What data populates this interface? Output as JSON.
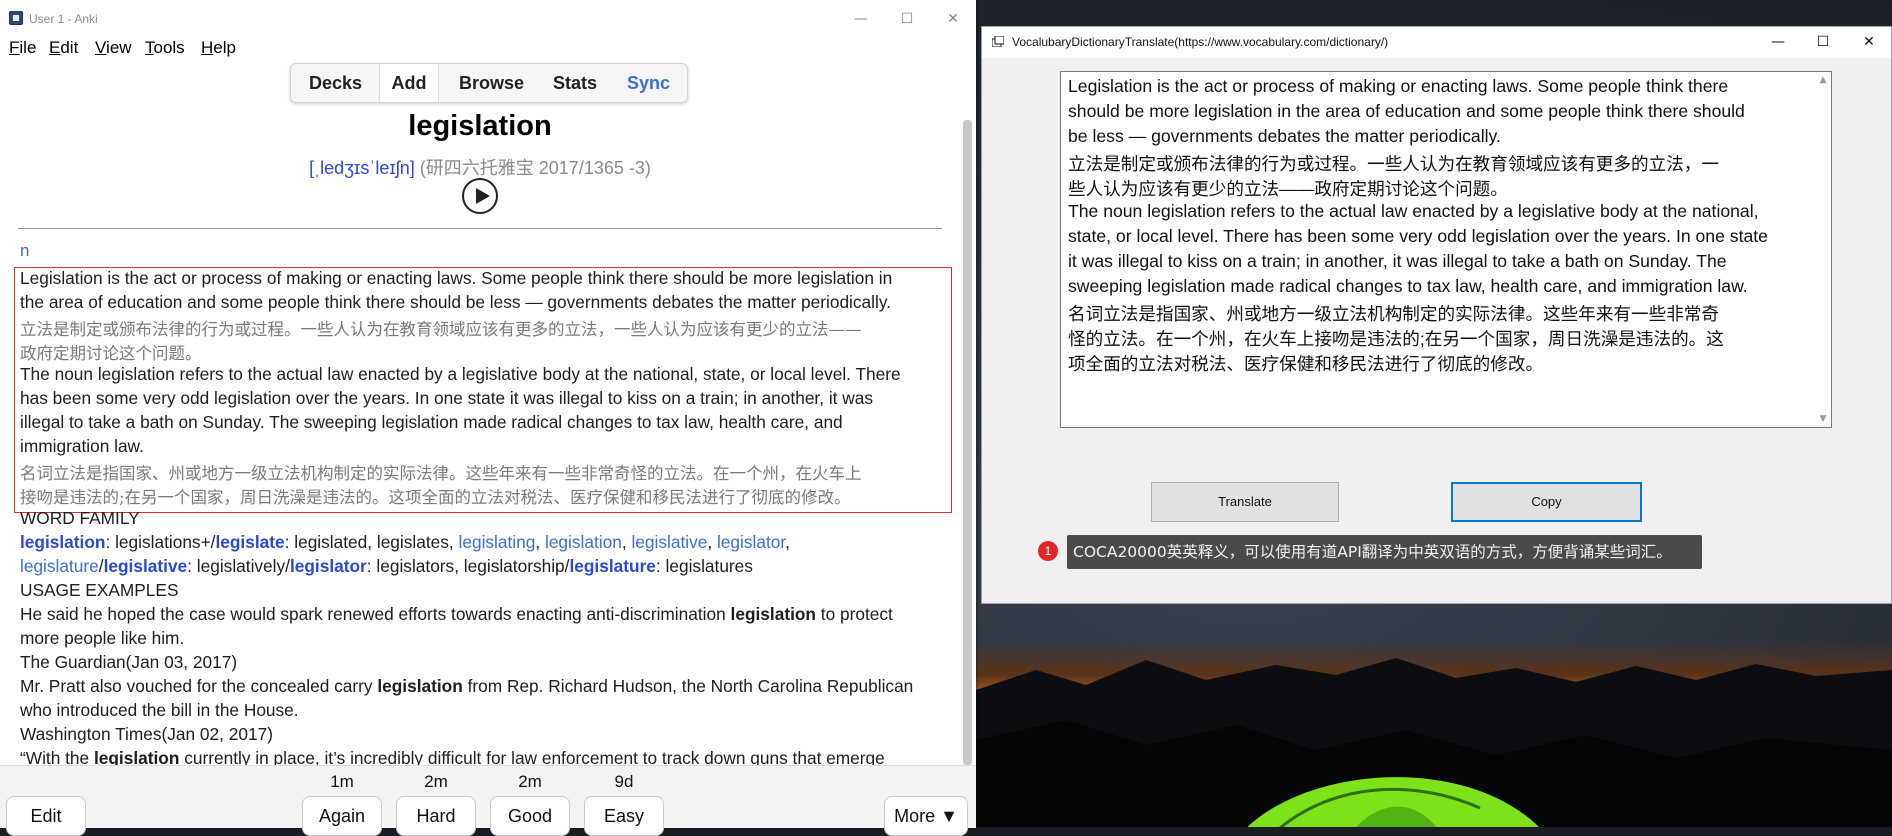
{
  "anki": {
    "window_title": "User 1 - Anki",
    "menu": [
      "File",
      "Edit",
      "View",
      "Tools",
      "Help"
    ],
    "menu_underline": [
      "F",
      "E",
      "V",
      "T",
      "H"
    ],
    "menu_rest": [
      "ile",
      "dit",
      "iew",
      "ools",
      "elp"
    ],
    "toolbar": {
      "decks": "Decks",
      "add": "Add",
      "browse": "Browse",
      "stats": "Stats",
      "sync": "Sync"
    },
    "card": {
      "word": "legislation",
      "ipa": "[ˌledʒɪsˈleɪʃn]",
      "tag": "(研四六托雅宝 2017/1365 -3)",
      "pos": "n",
      "def_en_1": [
        "Legislation is the act or process of making or enacting laws. Some people think there should be more legislation in",
        "the area of education and some people think there should be less — governments debates the matter periodically."
      ],
      "def_cn_1": [
        "立法是制定或颁布法律的行为或过程。一些人认为在教育领域应该有更多的立法，一些人认为应该有更少的立法——",
        "政府定期讨论这个问题。"
      ],
      "def_en_2": [
        "The noun legislation refers to the actual law enacted by a legislative body at the national, state, or local level. There",
        "has been some very odd legislation over the years. In one state it was illegal to kiss on a train; in another, it was",
        "illegal to take a bath on Sunday. The sweeping legislation made radical changes to tax law, health care, and",
        "immigration law."
      ],
      "def_cn_2": [
        "名词立法是指国家、州或地方一级立法机构制定的实际法律。这些年来有一些非常奇怪的立法。在一个州，在火车上",
        "接吻是违法的;在另一个国家，周日洗澡是违法的。这项全面的立法对税法、医疗保健和移民法进行了彻底的修改。"
      ],
      "word_family_heading": "WORD FAMILY",
      "wf1": {
        "w1": "legislation",
        "t1": ": legislations+/",
        "w2": "legislate",
        "t2": ": legislated, legislates, ",
        "l1": "legislating",
        "c1": ", ",
        "l2": "legislation",
        "c2": ", ",
        "l3": "legislative",
        "c3": ", ",
        "l4": "legislator",
        "c4": ","
      },
      "wf2": {
        "l1": "legislature",
        "s1": "/",
        "w1": "legislative",
        "t1": ": legislatively/",
        "w2": "legislator",
        "t2": ": legislators, legislatorship/",
        "w3": "legislature",
        "t3": ": legislatures"
      },
      "usage_heading": "USAGE EXAMPLES",
      "ex1": {
        "a": "He said he hoped the case would spark renewed efforts towards enacting anti-discrimination ",
        "b": "legislation",
        "c": " to protect",
        "d": "more people like him."
      },
      "src1": "The Guardian(Jan 03, 2017)",
      "ex2": {
        "a": "Mr. Pratt also vouched for the concealed carry ",
        "b": "legislation",
        "c": " from Rep. Richard Hudson, the North Carolina Republican",
        "d": "who introduced the bill in the House."
      },
      "src2": "Washington Times(Jan 02, 2017)",
      "ex3": {
        "a": "“With the ",
        "b": "legislation",
        "c": " currently in place, it’s incredibly difficult for law enforcement to track down guns that emerge"
      }
    },
    "bottom": {
      "edit": "Edit",
      "intervals": [
        "1m",
        "2m",
        "2m",
        "9d"
      ],
      "again": "Again",
      "hard": "Hard",
      "good": "Good",
      "easy": "Easy",
      "more": "More ▼"
    }
  },
  "translator": {
    "window_title": "VocalubaryDictionaryTranslate(https://www.vocabulary.com/dictionary/)",
    "text_lines": [
      "Legislation is the act or process of making or enacting laws. Some people think there",
      "should be more legislation in the area of education and some people think there should",
      "be less — governments debates the matter periodically.",
      "立法是制定或颁布法律的行为或过程。一些人认为在教育领域应该有更多的立法，一",
      "些人认为应该有更少的立法——政府定期讨论这个问题。",
      "The noun legislation refers to the actual law enacted by a legislative body at the national,",
      "state, or local level. There has been some very odd legislation over the years. In one state",
      "it was illegal to kiss on a train; in another, it was illegal to take a bath on Sunday. The",
      "sweeping legislation made radical changes to tax law, health care, and immigration law.",
      "名词立法是指国家、州或地方一级立法机构制定的实际法律。这些年来有一些非常奇",
      "怪的立法。在一个州，在火车上接吻是违法的;在另一个国家，周日洗澡是违法的。这",
      "项全面的立法对税法、医疗保健和移民法进行了彻底的修改。"
    ],
    "translate_label": "Translate",
    "copy_label": "Copy",
    "badge": "1",
    "tooltip": "COCA20000英英释义，可以使用有道API翻译为中英双语的方式，方便背诵某些词汇。"
  },
  "colors": {
    "accent_blue": "#3b6fd6",
    "word_blue": "#2b48d6",
    "highlight_border": "#d9322c",
    "focus_blue": "#0078d7"
  }
}
